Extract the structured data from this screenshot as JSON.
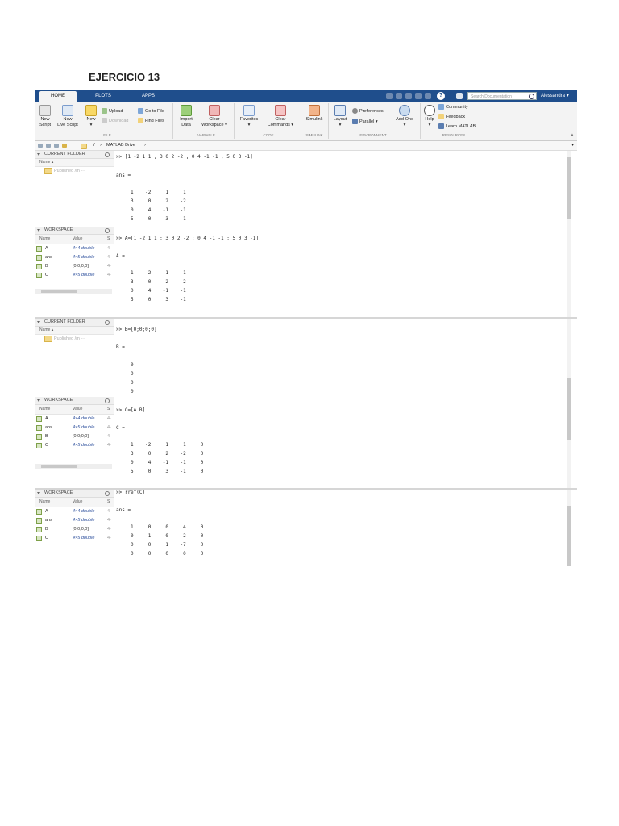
{
  "page_title": "EJERCICIO 13",
  "tabs": [
    "HOME",
    "PLOTS",
    "APPS"
  ],
  "search_placeholder": "Search Documentation",
  "user_name": "Alessandra",
  "ribbon": {
    "new_script": [
      "New",
      "Script"
    ],
    "new_live": [
      "New",
      "Live Script"
    ],
    "new": "New",
    "upload": "Upload",
    "download": "Download",
    "go_to_file": "Go to File",
    "find_files": "Find Files",
    "import_data": [
      "Import",
      "Data"
    ],
    "clear_workspace": [
      "Clear",
      "Workspace"
    ],
    "favorites": "Favorites",
    "clear_commands": [
      "Clear",
      "Commands"
    ],
    "simulink": "Simulink",
    "layout": "Layout",
    "preferences": "Preferences",
    "parallel": "Parallel",
    "addons": "Add-Ons",
    "help": "Help",
    "community": "Community",
    "feedback": "Feedback",
    "learn_matlab": "Learn MATLAB",
    "groups": [
      "FILE",
      "VARIABLE",
      "CODE",
      "SIMULINK",
      "ENVIRONMENT",
      "RESOURCES"
    ]
  },
  "address": {
    "sep": "/",
    "path": "MATLAB Drive"
  },
  "panels": {
    "current_folder": "CURRENT FOLDER",
    "workspace": "WORKSPACE",
    "col_name": "Name",
    "col_value": "Value",
    "col_s": "S",
    "published": "Published /m",
    "ws_rows_1": [
      {
        "name": "A",
        "value": "4×4 double",
        "s": "4-"
      },
      {
        "name": "ans",
        "value": "4×5 double",
        "s": "4-"
      },
      {
        "name": "B",
        "value": "[0;0;0;0]",
        "s": "4-"
      },
      {
        "name": "C",
        "value": "4×5 double",
        "s": "4-"
      }
    ],
    "ws_rows_3": [
      {
        "name": "A",
        "value": "4×4 double",
        "s": "4-"
      },
      {
        "name": "ans",
        "value": "4×5 double",
        "s": "4-"
      },
      {
        "name": "B",
        "value": "[0;0;0;0]",
        "s": "4-"
      },
      {
        "name": "C",
        "value": "4×5 double",
        "s": "4-"
      }
    ]
  },
  "console1": {
    "cmd1": ">> [1 -2 1 1 ; 3 0 2 -2 ; 0 4 -1 -1 ; 5 0 3 -1]",
    "out1_label": "ans =",
    "out1_rows": [
      "     1    -2     1     1",
      "     3     0     2    -2",
      "     0     4    -1    -1",
      "     5     0     3    -1"
    ],
    "cmd2": ">> A=[1 -2 1 1 ; 3 0 2 -2 ; 0 4 -1 -1 ; 5 0 3 -1]",
    "out2_label": "A =",
    "out2_rows": [
      "     1    -2     1     1",
      "     3     0     2    -2",
      "     0     4    -1    -1",
      "     5     0     3    -1"
    ]
  },
  "console2": {
    "cmd1": ">> B=[0;0;0;0]",
    "out1_label": "B =",
    "out1_rows": [
      "     0",
      "     0",
      "     0",
      "     0"
    ],
    "cmd2": ">> C=[A B]",
    "out2_label": "C =",
    "out2_rows": [
      "     1    -2     1     1     0",
      "     3     0     2    -2     0",
      "     0     4    -1    -1     0",
      "     5     0     3    -1     0"
    ]
  },
  "console3": {
    "cmd1": ">> rref(C)",
    "out1_label": "ans =",
    "out1_rows": [
      "     1     0     0     4     0",
      "     0     1     0    -2     0",
      "     0     0     1    -7     0",
      "     0     0     0     0     0"
    ]
  }
}
